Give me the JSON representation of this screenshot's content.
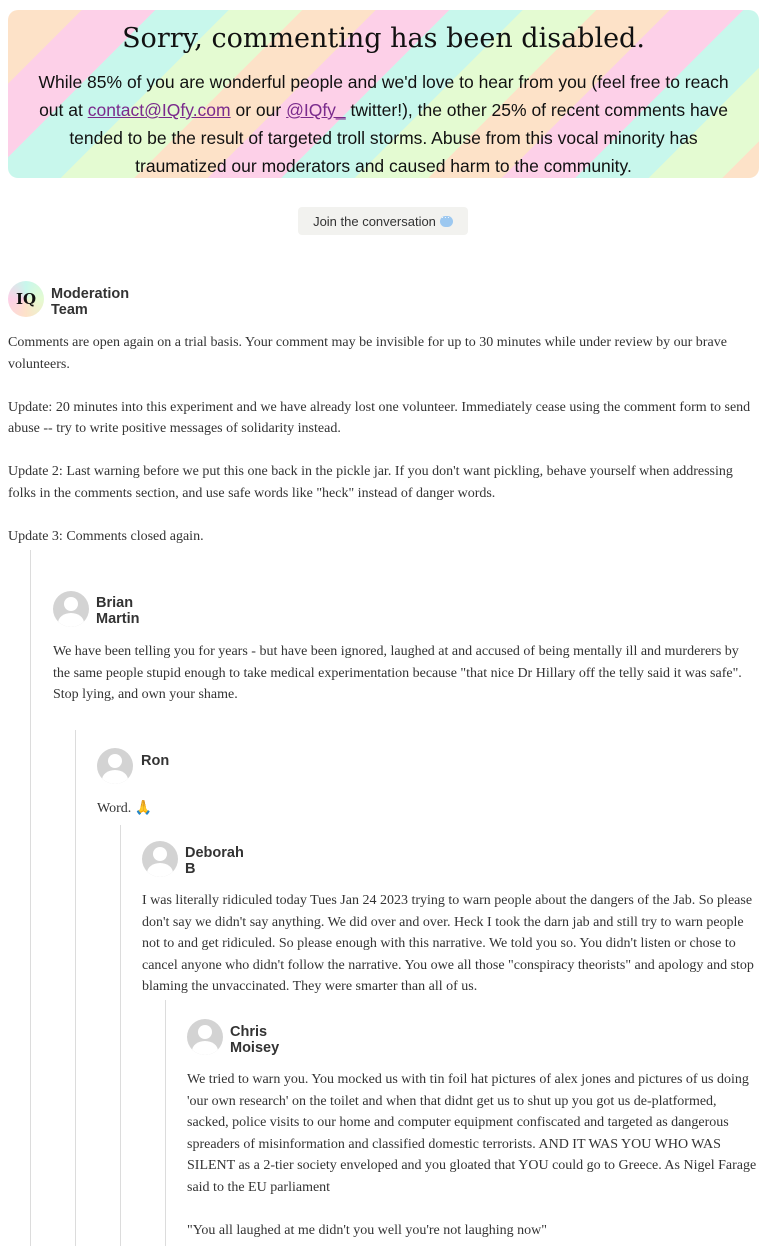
{
  "banner": {
    "title": "Sorry, commenting has been disabled.",
    "text_1": "While 85% of you are wonderful people and we'd love to hear from you (feel free to reach out at ",
    "email": "contact@IQfy.com",
    "text_2": " or our ",
    "twitter": "@IQfy_",
    "text_3": " twitter!), the other 25% of recent comments have tended to be the result of targeted troll storms. Abuse from this vocal minority has traumatized our moderators and caused harm to the community."
  },
  "join_button": {
    "label": "Join the conversation"
  },
  "comments": [
    {
      "author": "Moderation Team",
      "avatar_text": "IQ",
      "paragraphs": [
        "Comments are open again on a trial basis. Your comment may be invisible for up to 30 minutes while under review by our brave volunteers.",
        "Update: 20 minutes into this experiment and we have already lost one volunteer. Immediately cease using the comment form to send abuse -- try to write positive messages of solidarity instead.",
        "Update 2: Last warning before we put this one back in the pickle jar. If you don't want pickling, behave yourself when addressing folks in the comments section, and use safe words like \"heck\" instead of danger words.",
        "Update 3: Comments closed again."
      ]
    },
    {
      "author": "Brian Martin",
      "line_1": "We have been telling you for years - but have been ignored, laughed at and accused of being mentally ill and murderers by the same people stupid enough to take medical experimentation because \"that nice Dr Hillary off the telly said it was safe\".",
      "line_2": "Stop lying, and own your shame."
    },
    {
      "author": "Ron",
      "text": "Word. 🙏"
    },
    {
      "author": "Deborah B",
      "text": "I was literally ridiculed today Tues Jan 24 2023 trying to warn people about the dangers of the Jab. So please don't say we didn't say anything. We did over and over. Heck I took the darn jab and still try to warn people not to and get ridiculed. So please enough with this narrative. We told you so. You didn't listen or chose to cancel anyone who didn't follow the narrative. You owe all those \"conspiracy theorists\" and apology and stop blaming the unvaccinated. They were smarter than all of us."
    },
    {
      "author": "Chris Moisey",
      "text_1": "We tried to warn you. You mocked us with tin foil hat pictures of alex jones and pictures of us doing 'our own research' on the toilet and when that didnt get us to shut up you got us de-platformed, sacked, police visits to our home and computer equipment confiscated and targeted as dangerous spreaders of misinformation and classified domestic terrorists. AND IT WAS YOU WHO WAS SILENT as a 2-tier society enveloped and you gloated that YOU could go to Greece. As Nigel Farage said to the EU parliament",
      "text_2": "\"You all laughed at me didn't you well you're not laughing now\""
    }
  ]
}
